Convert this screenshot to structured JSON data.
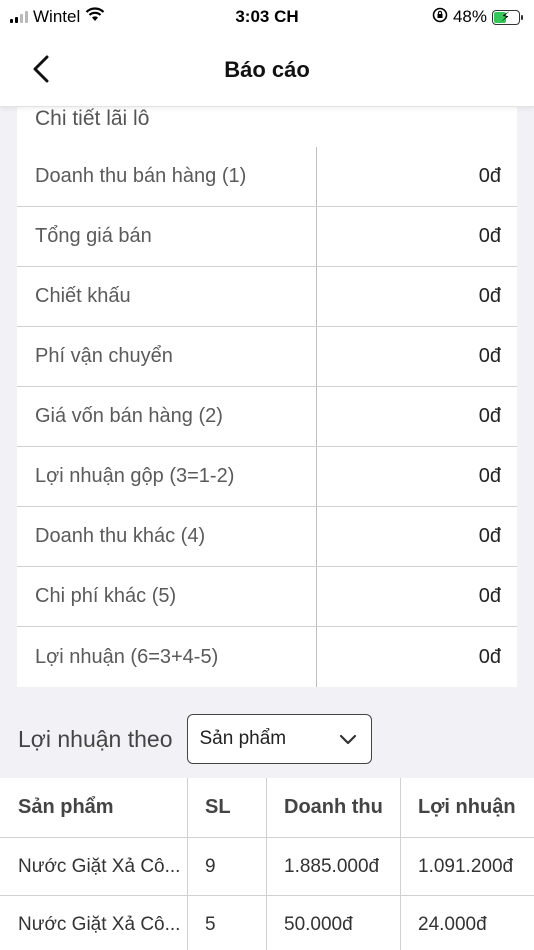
{
  "status_bar": {
    "carrier": "Wintel",
    "time": "3:03 CH",
    "battery": "48%",
    "battery_level": 0.48
  },
  "header": {
    "title": "Báo cáo",
    "back_icon": "chevron-left-icon"
  },
  "detail": {
    "section_title": "Chi tiết lãi lô",
    "rows": [
      {
        "label": "Doanh thu bán hàng (1)",
        "value": "0đ"
      },
      {
        "label": "Tổng giá bán",
        "value": "0đ"
      },
      {
        "label": "Chiết khấu",
        "value": "0đ"
      },
      {
        "label": "Phí vận chuyển",
        "value": "0đ"
      },
      {
        "label": "Giá vốn bán hàng (2)",
        "value": "0đ"
      },
      {
        "label": "Lợi nhuận gộp (3=1-2)",
        "value": "0đ"
      },
      {
        "label": "Doanh thu khác (4)",
        "value": "0đ"
      },
      {
        "label": "Chi phí khác (5)",
        "value": "0đ"
      },
      {
        "label": "Lợi nhuận (6=3+4-5)",
        "value": "0đ"
      }
    ]
  },
  "profit_by": {
    "label": "Lợi nhuận theo",
    "selected": "Sản phẩm"
  },
  "product_table": {
    "headers": [
      "Sản phẩm",
      "SL",
      "Doanh thu",
      "Lợi nhuận"
    ],
    "rows": [
      [
        "Nước Giặt Xả Cô...",
        "9",
        "1.885.000đ",
        "1.091.200đ"
      ],
      [
        "Nước Giặt Xả Cô...",
        "5",
        "50.000đ",
        "24.000đ"
      ]
    ]
  }
}
